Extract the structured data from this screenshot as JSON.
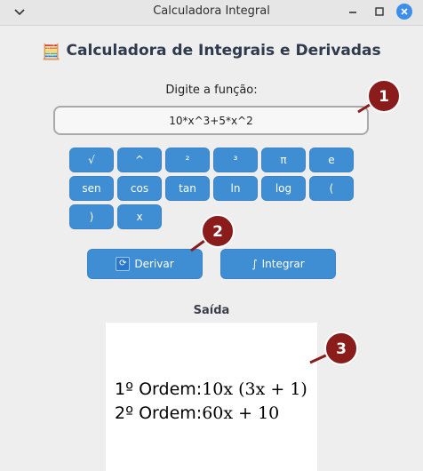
{
  "window": {
    "title": "Calculadora Integral"
  },
  "app": {
    "emoji": "🧮",
    "title": "Calculadora de Integrais e Derivadas",
    "prompt": "Digite a função:",
    "function_value": "10*x^3+5*x^2"
  },
  "keypad": [
    {
      "label": "√",
      "name": "key-sqrt"
    },
    {
      "label": "^",
      "name": "key-power"
    },
    {
      "label": "²",
      "name": "key-square"
    },
    {
      "label": "³",
      "name": "key-cube"
    },
    {
      "label": "π",
      "name": "key-pi"
    },
    {
      "label": "e",
      "name": "key-e"
    },
    {
      "label": "sen",
      "name": "key-sen"
    },
    {
      "label": "cos",
      "name": "key-cos"
    },
    {
      "label": "tan",
      "name": "key-tan"
    },
    {
      "label": "ln",
      "name": "key-ln"
    },
    {
      "label": "log",
      "name": "key-log"
    },
    {
      "label": "(",
      "name": "key-open-paren"
    },
    {
      "label": ")",
      "name": "key-close-paren"
    },
    {
      "label": "x",
      "name": "key-x"
    }
  ],
  "actions": {
    "derivar_label": "Derivar",
    "integrar_icon": "∫",
    "integrar_label": "Integrar"
  },
  "output": {
    "label": "Saída",
    "lines": [
      {
        "prefix": "1º Ordem:",
        "math": "10x (3x + 1)"
      },
      {
        "prefix": "2º Ordem:",
        "math": "60x + 10"
      }
    ]
  },
  "markers": [
    "1",
    "2",
    "3"
  ],
  "colors": {
    "button": "#3f8dd2",
    "marker": "#8a1c1c",
    "close": "#3d8ee8"
  }
}
